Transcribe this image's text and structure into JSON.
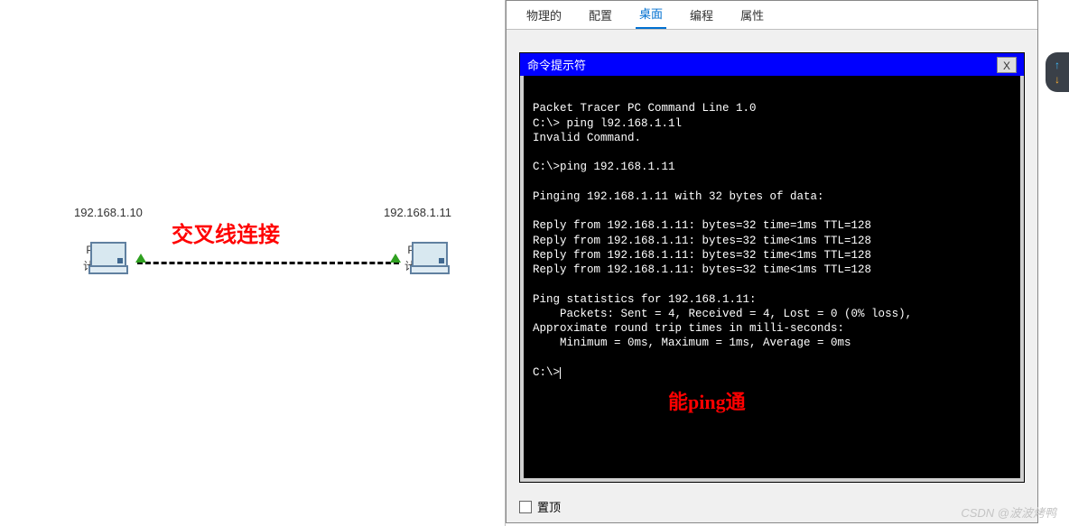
{
  "left": {
    "ip1": "192.168.1.10",
    "ip2": "192.168.1.11",
    "pc1_type": "PC-PT",
    "pc1_name": "计算机0",
    "pc2_type": "PC-PT",
    "pc2_name": "计算机1",
    "cable_label": "交叉线连接"
  },
  "tabs": {
    "t0": "物理的",
    "t1": "配置",
    "t2": "桌面",
    "t3": "编程",
    "t4": "属性"
  },
  "cmd": {
    "title": "命令提示符",
    "close": "X",
    "lines": "\nPacket Tracer PC Command Line 1.0\nC:\\> ping l92.168.1.1l\nInvalid Command.\n\nC:\\>ping 192.168.1.11\n\nPinging 192.168.1.11 with 32 bytes of data:\n\nReply from 192.168.1.11: bytes=32 time=1ms TTL=128\nReply from 192.168.1.11: bytes=32 time<1ms TTL=128\nReply from 192.168.1.11: bytes=32 time<1ms TTL=128\nReply from 192.168.1.11: bytes=32 time<1ms TTL=128\n\nPing statistics for 192.168.1.11:\n    Packets: Sent = 4, Received = 4, Lost = 0 (0% loss),\nApproximate round trip times in milli-seconds:\n    Minimum = 0ms, Maximum = 1ms, Average = 0ms\n\nC:\\>"
  },
  "annotation": "能ping通",
  "bottom": {
    "label": "置顶"
  },
  "watermark": "CSDN @波波烤鸭"
}
